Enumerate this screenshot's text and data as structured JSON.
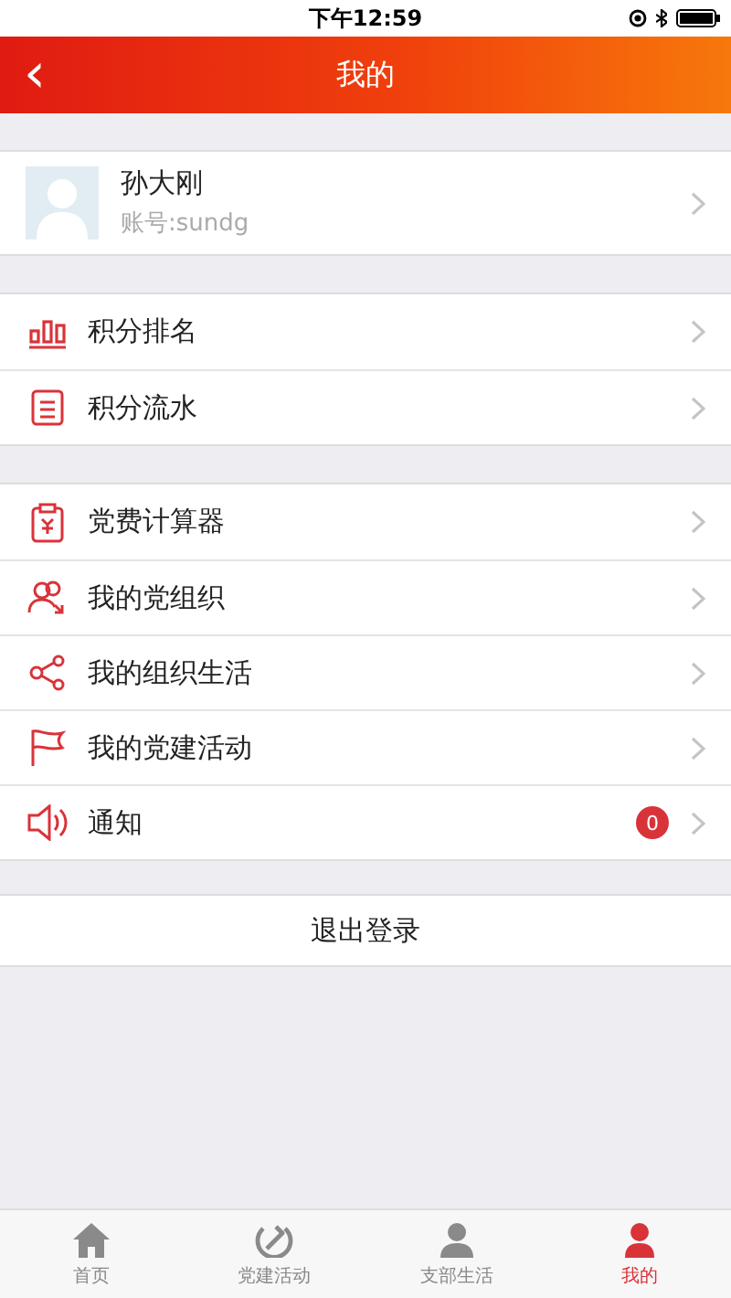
{
  "status_bar": {
    "time": "下午12:59"
  },
  "header": {
    "back": "‹",
    "title": "我的"
  },
  "profile": {
    "name": "孙大刚",
    "account": "账号:sundg"
  },
  "groups": [
    {
      "items": [
        {
          "label": "积分排名"
        },
        {
          "label": "积分流水"
        }
      ]
    },
    {
      "items": [
        {
          "label": "党费计算器"
        },
        {
          "label": "我的党组织"
        },
        {
          "label": "我的组织生活"
        },
        {
          "label": "我的党建活动"
        },
        {
          "label": "通知",
          "badge": "0"
        }
      ]
    }
  ],
  "logout": "退出登录",
  "tabs": [
    {
      "label": "首页",
      "selected": false
    },
    {
      "label": "党建活动",
      "selected": false
    },
    {
      "label": "支部生活",
      "selected": false
    },
    {
      "label": "我的",
      "selected": true
    }
  ]
}
